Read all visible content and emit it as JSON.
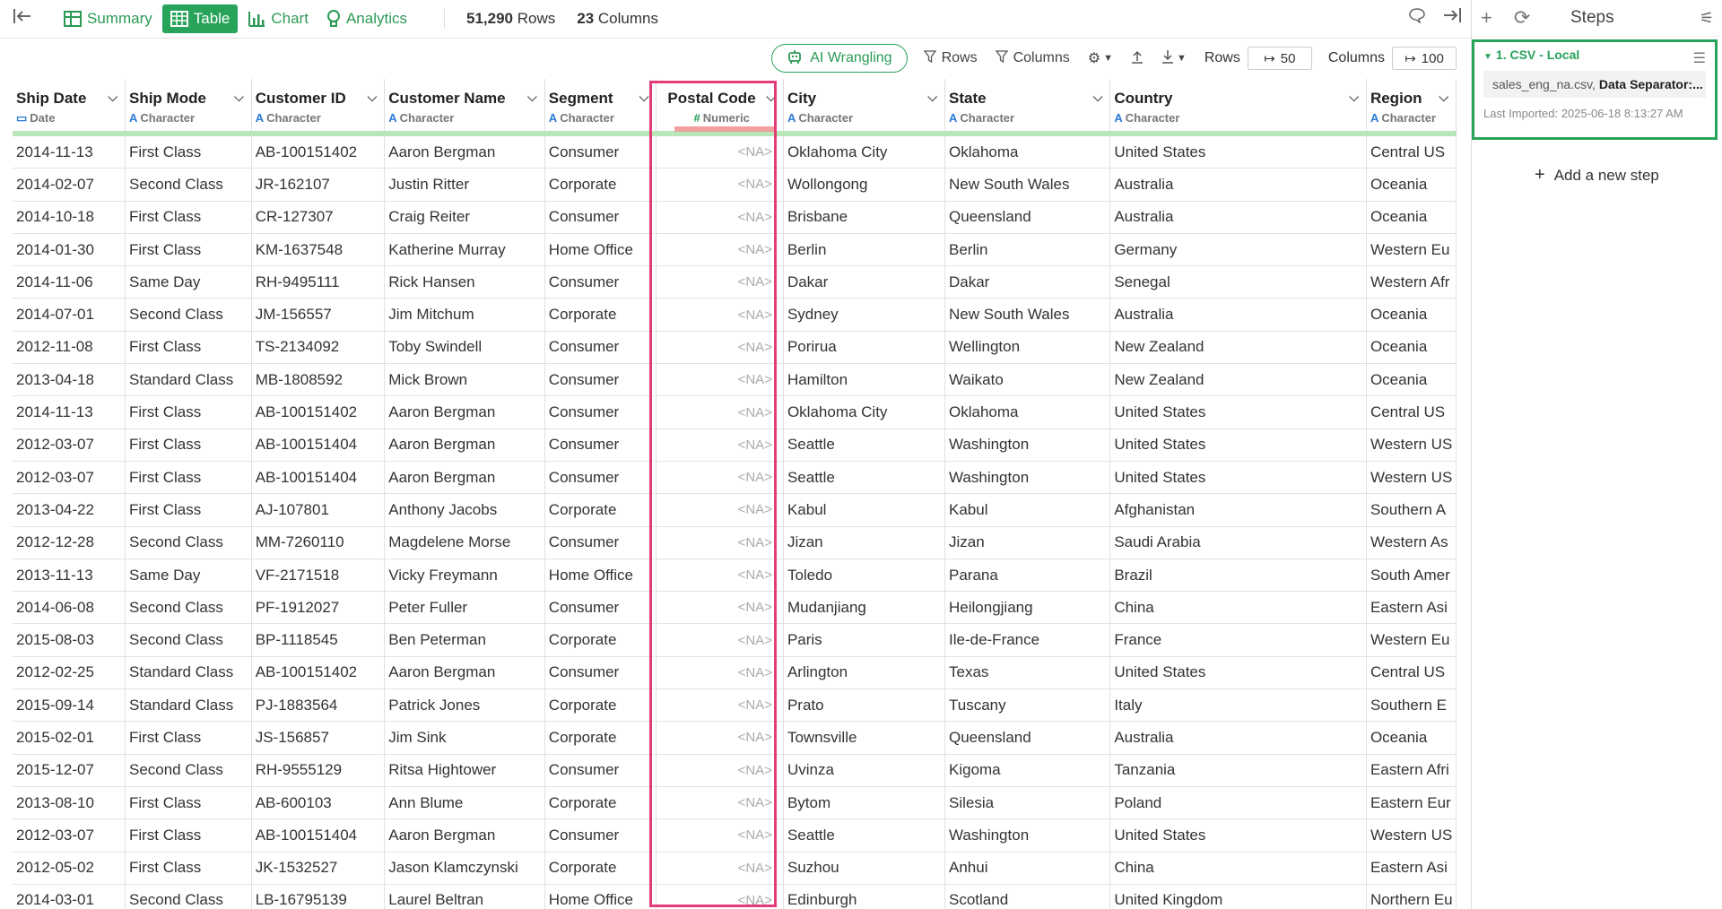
{
  "topbar": {
    "tabs": [
      {
        "label": "Summary",
        "icon": "summary-icon"
      },
      {
        "label": "Table",
        "icon": "table-icon"
      },
      {
        "label": "Chart",
        "icon": "chart-icon"
      },
      {
        "label": "Analytics",
        "icon": "analytics-icon"
      }
    ],
    "rows_count": "51,290",
    "rows_label": "Rows",
    "cols_count": "23",
    "cols_label": "Columns"
  },
  "toolbar": {
    "ai_label": "AI Wrangling",
    "rows_filter": "Rows",
    "cols_filter": "Columns",
    "rows_label": "Rows",
    "rows_value": "50",
    "cols_label": "Columns",
    "cols_value": "100"
  },
  "columns": [
    {
      "name": "Ship Date",
      "type": "Date",
      "icon": "calendar-icon"
    },
    {
      "name": "Ship Mode",
      "type": "Character",
      "icon": "character-type-icon"
    },
    {
      "name": "Customer ID",
      "type": "Character",
      "icon": "character-type-icon"
    },
    {
      "name": "Customer Name",
      "type": "Character",
      "icon": "character-type-icon"
    },
    {
      "name": "Segment",
      "type": "Character",
      "icon": "character-type-icon"
    },
    {
      "name": "Postal Code",
      "type": "Numeric",
      "icon": "numeric-type-icon"
    },
    {
      "name": "City",
      "type": "Character",
      "icon": "character-type-icon"
    },
    {
      "name": "State",
      "type": "Character",
      "icon": "character-type-icon"
    },
    {
      "name": "Country",
      "type": "Character",
      "icon": "character-type-icon"
    },
    {
      "name": "Region",
      "type": "Character",
      "icon": "character-type-icon"
    }
  ],
  "rows": [
    [
      "2014-11-13",
      "First Class",
      "AB-100151402",
      "Aaron Bergman",
      "Consumer",
      "<NA>",
      "Oklahoma City",
      "Oklahoma",
      "United States",
      "Central US"
    ],
    [
      "2014-02-07",
      "Second Class",
      "JR-162107",
      "Justin Ritter",
      "Corporate",
      "<NA>",
      "Wollongong",
      "New South Wales",
      "Australia",
      "Oceania"
    ],
    [
      "2014-10-18",
      "First Class",
      "CR-127307",
      "Craig Reiter",
      "Consumer",
      "<NA>",
      "Brisbane",
      "Queensland",
      "Australia",
      "Oceania"
    ],
    [
      "2014-01-30",
      "First Class",
      "KM-1637548",
      "Katherine Murray",
      "Home Office",
      "<NA>",
      "Berlin",
      "Berlin",
      "Germany",
      "Western Eu"
    ],
    [
      "2014-11-06",
      "Same Day",
      "RH-9495111",
      "Rick Hansen",
      "Consumer",
      "<NA>",
      "Dakar",
      "Dakar",
      "Senegal",
      "Western Afr"
    ],
    [
      "2014-07-01",
      "Second Class",
      "JM-156557",
      "Jim Mitchum",
      "Corporate",
      "<NA>",
      "Sydney",
      "New South Wales",
      "Australia",
      "Oceania"
    ],
    [
      "2012-11-08",
      "First Class",
      "TS-2134092",
      "Toby Swindell",
      "Consumer",
      "<NA>",
      "Porirua",
      "Wellington",
      "New Zealand",
      "Oceania"
    ],
    [
      "2013-04-18",
      "Standard Class",
      "MB-1808592",
      "Mick Brown",
      "Consumer",
      "<NA>",
      "Hamilton",
      "Waikato",
      "New Zealand",
      "Oceania"
    ],
    [
      "2014-11-13",
      "First Class",
      "AB-100151402",
      "Aaron Bergman",
      "Consumer",
      "<NA>",
      "Oklahoma City",
      "Oklahoma",
      "United States",
      "Central US"
    ],
    [
      "2012-03-07",
      "First Class",
      "AB-100151404",
      "Aaron Bergman",
      "Consumer",
      "<NA>",
      "Seattle",
      "Washington",
      "United States",
      "Western US"
    ],
    [
      "2012-03-07",
      "First Class",
      "AB-100151404",
      "Aaron Bergman",
      "Consumer",
      "<NA>",
      "Seattle",
      "Washington",
      "United States",
      "Western US"
    ],
    [
      "2013-04-22",
      "First Class",
      "AJ-107801",
      "Anthony Jacobs",
      "Corporate",
      "<NA>",
      "Kabul",
      "Kabul",
      "Afghanistan",
      "Southern A"
    ],
    [
      "2012-12-28",
      "Second Class",
      "MM-7260110",
      "Magdelene Morse",
      "Consumer",
      "<NA>",
      "Jizan",
      "Jizan",
      "Saudi Arabia",
      "Western As"
    ],
    [
      "2013-11-13",
      "Same Day",
      "VF-2171518",
      "Vicky Freymann",
      "Home Office",
      "<NA>",
      "Toledo",
      "Parana",
      "Brazil",
      "South Amer"
    ],
    [
      "2014-06-08",
      "Second Class",
      "PF-1912027",
      "Peter Fuller",
      "Consumer",
      "<NA>",
      "Mudanjiang",
      "Heilongjiang",
      "China",
      "Eastern Asi"
    ],
    [
      "2015-08-03",
      "Second Class",
      "BP-1118545",
      "Ben Peterman",
      "Corporate",
      "<NA>",
      "Paris",
      "Ile-de-France",
      "France",
      "Western Eu"
    ],
    [
      "2012-02-25",
      "Standard Class",
      "AB-100151402",
      "Aaron Bergman",
      "Consumer",
      "<NA>",
      "Arlington",
      "Texas",
      "United States",
      "Central US"
    ],
    [
      "2015-09-14",
      "Standard Class",
      "PJ-1883564",
      "Patrick Jones",
      "Corporate",
      "<NA>",
      "Prato",
      "Tuscany",
      "Italy",
      "Southern E"
    ],
    [
      "2015-02-01",
      "First Class",
      "JS-156857",
      "Jim Sink",
      "Corporate",
      "<NA>",
      "Townsville",
      "Queensland",
      "Australia",
      "Oceania"
    ],
    [
      "2015-12-07",
      "Second Class",
      "RH-9555129",
      "Ritsa Hightower",
      "Consumer",
      "<NA>",
      "Uvinza",
      "Kigoma",
      "Tanzania",
      "Eastern Afri"
    ],
    [
      "2013-08-10",
      "First Class",
      "AB-600103",
      "Ann Blume",
      "Corporate",
      "<NA>",
      "Bytom",
      "Silesia",
      "Poland",
      "Eastern Eur"
    ],
    [
      "2012-03-07",
      "First Class",
      "AB-100151404",
      "Aaron Bergman",
      "Consumer",
      "<NA>",
      "Seattle",
      "Washington",
      "United States",
      "Western US"
    ],
    [
      "2012-05-02",
      "First Class",
      "JK-1532527",
      "Jason Klamczynski",
      "Corporate",
      "<NA>",
      "Suzhou",
      "Anhui",
      "China",
      "Eastern Asi"
    ],
    [
      "2014-03-01",
      "Second Class",
      "LB-16795139",
      "Laurel Beltran",
      "Home Office",
      "<NA>",
      "Edinburgh",
      "Scotland",
      "United Kingdom",
      "Northern Eu"
    ]
  ],
  "steps_panel": {
    "title": "Steps",
    "step_title": "1. CSV - Local",
    "file_name": "sales_eng_na.csv,",
    "file_detail": "Data Separator:...",
    "last_imported": "Last Imported: 2025-06-18 8:13:27 AM",
    "add_step": "Add a new step"
  },
  "colors": {
    "accent": "#27a35a",
    "highlight": "#e23c7a",
    "type_icon": "#2a7ad5"
  }
}
